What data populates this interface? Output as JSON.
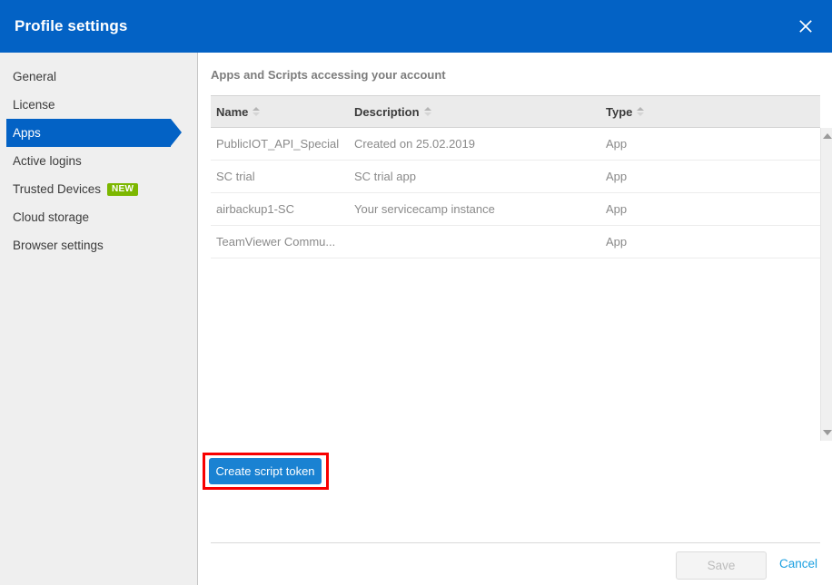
{
  "window": {
    "title": "Profile settings",
    "close_icon": "close-icon",
    "header_color": "#0362c5"
  },
  "sidebar": {
    "items": [
      {
        "label": "General",
        "active": false,
        "badge": null
      },
      {
        "label": "License",
        "active": false,
        "badge": null
      },
      {
        "label": "Apps",
        "active": true,
        "badge": null
      },
      {
        "label": "Active logins",
        "active": false,
        "badge": null
      },
      {
        "label": "Trusted Devices",
        "active": false,
        "badge": "NEW"
      },
      {
        "label": "Cloud storage",
        "active": false,
        "badge": null
      },
      {
        "label": "Browser settings",
        "active": false,
        "badge": null
      }
    ],
    "active_color": "#0362c5",
    "badge_color": "#7cb700"
  },
  "main": {
    "section_title": "Apps and Scripts accessing your account",
    "table": {
      "columns": [
        {
          "label": "Name",
          "sortable": true
        },
        {
          "label": "Description",
          "sortable": true
        },
        {
          "label": "Type",
          "sortable": true
        }
      ],
      "rows": [
        {
          "name": "PublicIOT_API_Special",
          "description": "Created on 25.02.2019",
          "type": "App"
        },
        {
          "name": "SC trial",
          "description": "SC trial app",
          "type": "App"
        },
        {
          "name": "airbackup1-SC",
          "description": "Your servicecamp instance",
          "type": "App"
        },
        {
          "name": "TeamViewer Commu...",
          "description": "",
          "type": "App"
        }
      ]
    },
    "scrollbar": {
      "up_icon": "triangle-up-icon",
      "down_icon": "triangle-down-icon"
    },
    "create_token_button": {
      "label": "Create script token",
      "color": "#1a82d2",
      "highlight_color": "#f80000"
    }
  },
  "footer": {
    "save_label": "Save",
    "save_disabled": true,
    "cancel_label": "Cancel",
    "cancel_color": "#1a9fe0"
  }
}
